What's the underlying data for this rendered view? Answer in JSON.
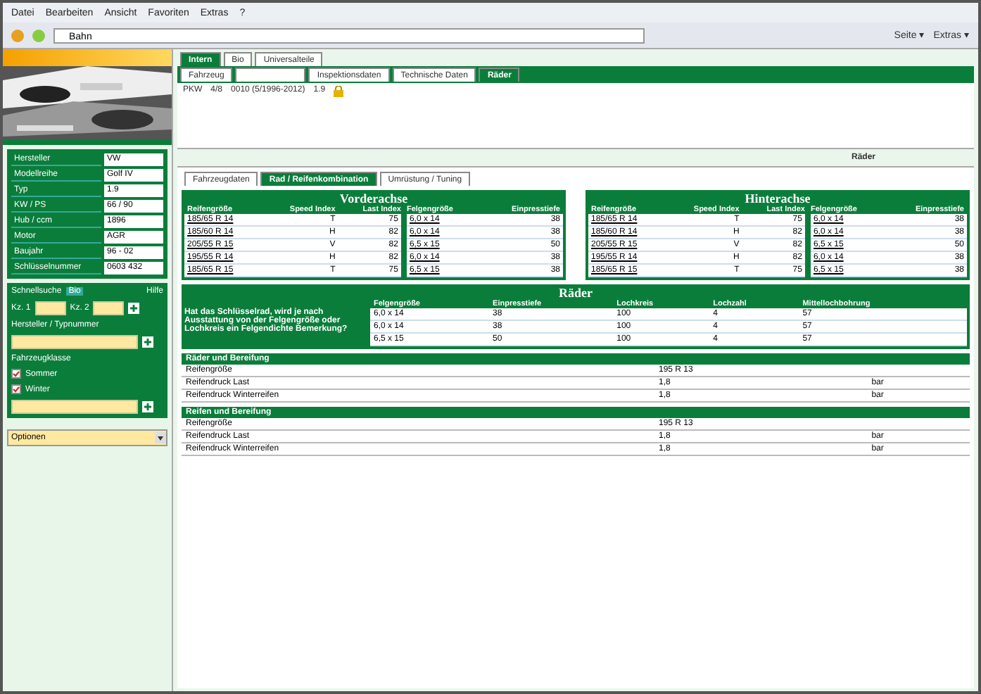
{
  "menu": [
    "Datei",
    "Bearbeiten",
    "Ansicht",
    "Favoriten",
    "Extras",
    "?"
  ],
  "address": "Bahn",
  "toolbar_right": [
    "Seite ▾",
    "Extras ▾"
  ],
  "sidebar": {
    "vehicle": [
      {
        "label": "Hersteller",
        "value": "VW"
      },
      {
        "label": "Modellreihe",
        "value": "Golf IV"
      },
      {
        "label": "Typ",
        "value": "1.9"
      },
      {
        "label": "KW / PS",
        "value": "66 / 90"
      },
      {
        "label": "Hub / ccm",
        "value": "1896"
      },
      {
        "label": "Motor",
        "value": "AGR"
      },
      {
        "label": "Baujahr",
        "value": "96 - 02"
      },
      {
        "label": "Schlüsselnummer",
        "value": "0603 432"
      }
    ],
    "search": {
      "title": "Schnellsuche",
      "link": "Bio",
      "help": "Hilfe",
      "kz1": "Kz. 1",
      "kz2": "Kz. 2",
      "type_label": "Hersteller / Typnummer",
      "class_label": "Fahrzeugklasse",
      "checks": [
        {
          "label": "Sommer",
          "checked": true
        },
        {
          "label": "Winter",
          "checked": true
        }
      ]
    },
    "select": "Optionen"
  },
  "main_tabs": [
    {
      "label": "Intern",
      "selected": true
    },
    {
      "label": "Bio",
      "selected": false
    },
    {
      "label": "Universalteile",
      "selected": false
    }
  ],
  "sub_tabs": [
    {
      "label": "Fahrzeug",
      "selected": false
    },
    {
      "selected": false
    },
    {
      "label": "Inspektionsdaten",
      "selected": false
    },
    {
      "label": "Technische Daten",
      "selected": false
    },
    {
      "label": "Räder",
      "selected": true
    }
  ],
  "vehicle_line": [
    "PKW",
    "4/8",
    "0010 (5/1996-2012)",
    "1.9"
  ],
  "section_title": "Räder",
  "inner_tabs": [
    {
      "label": "Fahrzeugdaten",
      "selected": false
    },
    {
      "label": "Rad / Reifenkombination",
      "selected": true
    },
    {
      "label": "Umrüstung / Tuning",
      "selected": false
    }
  ],
  "axles": [
    {
      "title": "Vorderachse",
      "columns": [
        "Reifengröße",
        "Speed Index",
        "Last Index",
        "Felgengröße",
        "Einpresstiefe"
      ],
      "rows": [
        [
          "185/65 R 14",
          "T",
          "75",
          "6,0 x 14",
          "38"
        ],
        [
          "185/60 R 14",
          "H",
          "82",
          "6,0 x 14",
          "38"
        ],
        [
          "205/55 R 15",
          "V",
          "82",
          "6,5 x 15",
          "50"
        ],
        [
          "195/55 R 14",
          "H",
          "82",
          "6,0 x 14",
          "38"
        ],
        [
          "185/65 R 15",
          "T",
          "75",
          "6,5 x 15",
          "38"
        ]
      ]
    },
    {
      "title": "Hinterachse",
      "columns": [
        "Reifengröße",
        "Speed Index",
        "Last Index",
        "Felgengröße",
        "Einpresstiefe"
      ],
      "rows": [
        [
          "185/65 R 14",
          "T",
          "75",
          "6,0 x 14",
          "38"
        ],
        [
          "185/60 R 14",
          "H",
          "82",
          "6,0 x 14",
          "38"
        ],
        [
          "205/55 R 15",
          "V",
          "82",
          "6,5 x 15",
          "50"
        ],
        [
          "195/55 R 14",
          "H",
          "82",
          "6,0 x 14",
          "38"
        ],
        [
          "185/65 R 15",
          "T",
          "75",
          "6,5 x 15",
          "38"
        ]
      ]
    }
  ],
  "wheels": {
    "title": "Räder",
    "note": "Hat das Schlüsselrad, wird je nach Ausstattung von der Felgengröße oder Lochkreis ein Felgendichte Bemerkung?",
    "columns": [
      "Felgengröße",
      "Einpresstiefe",
      "Lochkreis",
      "Lochzahl",
      "Mittellochbohrung"
    ],
    "rows": [
      [
        "6,0 x 14",
        "38",
        "100",
        "4",
        "57"
      ],
      [
        "6,0 x 14",
        "38",
        "100",
        "4",
        "57"
      ],
      [
        "6,5 x 15",
        "50",
        "100",
        "4",
        "57"
      ]
    ]
  },
  "tire_sections": [
    {
      "title": "Räder und Bereifung",
      "rows": [
        [
          "Reifengröße",
          "195 R 13",
          ""
        ],
        [
          "Reifendruck Last",
          "1,8",
          "bar"
        ],
        [
          "Reifendruck Winterreifen",
          "1,8",
          "bar"
        ]
      ]
    },
    {
      "title": "Reifen und Bereifung",
      "rows": [
        [
          "Reifengröße",
          "195 R 13",
          ""
        ],
        [
          "Reifendruck Last",
          "1,8",
          "bar"
        ],
        [
          "Reifendruck Winterreifen",
          "1,8",
          "bar"
        ]
      ]
    }
  ]
}
